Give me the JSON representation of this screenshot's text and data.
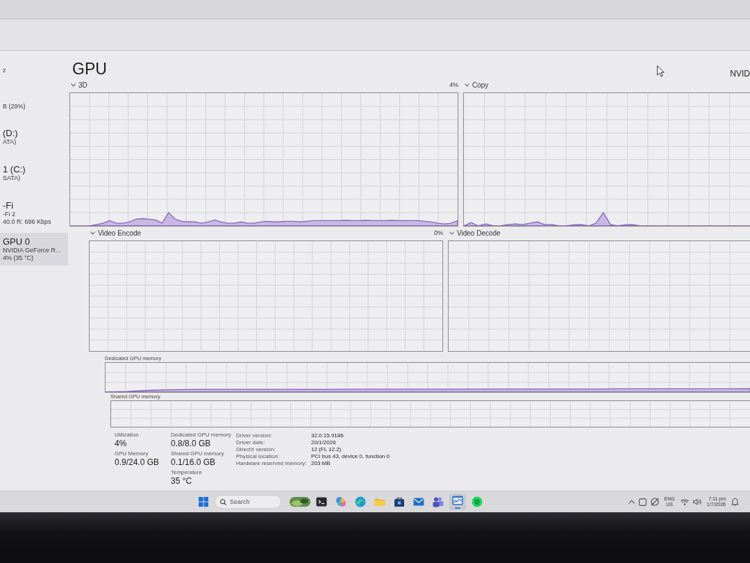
{
  "sidebar": {
    "items": [
      {
        "details": [
          "z"
        ],
        "selected": false
      },
      {
        "details": [
          "B (29%)"
        ],
        "selected": false
      },
      {
        "title": "(D:)",
        "details": [
          "ATA)"
        ],
        "selected": false
      },
      {
        "title": "1 (C:)",
        "details": [
          "SATA)"
        ],
        "selected": false
      },
      {
        "title": "-Fi",
        "details": [
          "-Fi 2",
          "40.0 R: 696 Kbps"
        ],
        "selected": false
      },
      {
        "title": "GPU 0",
        "details": [
          "NVIDIA GeForce R...",
          "4% (35 °C)"
        ],
        "selected": true
      }
    ]
  },
  "header": {
    "title": "GPU",
    "device": "NVID"
  },
  "engine_graphs": [
    {
      "label": "3D",
      "reading": "4%"
    },
    {
      "label": "Copy"
    },
    {
      "label": "Video Encode",
      "reading": "0%"
    },
    {
      "label": "Video Decode"
    }
  ],
  "memory_graphs": [
    {
      "label": "Dedicated GPU memory"
    },
    {
      "label": "Shared GPU memory"
    }
  ],
  "stat_columns": [
    [
      {
        "label": "Utilization",
        "value": "4%"
      },
      {
        "label": "GPU Memory",
        "value": "0.9/24.0 GB"
      }
    ],
    [
      {
        "label": "Dedicated GPU memory",
        "value": "0.8/8.0 GB"
      },
      {
        "label": "Shared GPU memory",
        "value": "0.1/16.0 GB"
      },
      {
        "label": "Temperature",
        "value": "35 °C"
      }
    ]
  ],
  "properties": [
    {
      "label": "Driver version:",
      "value": "32.0.15.9186"
    },
    {
      "label": "Driver date:",
      "value": "20/1/2026"
    },
    {
      "label": "DirectX version:",
      "value": "12 (FL 12.2)"
    },
    {
      "label": "Physical location:",
      "value": "PCI bus 43, device 0, function 0"
    },
    {
      "label": "Hardware reserved memory:",
      "value": "203 MB"
    }
  ],
  "taskbar": {
    "search": {
      "placeholder": "Search"
    },
    "apps": [
      {
        "selected": false
      },
      {
        "selected": false
      },
      {
        "selected": false
      },
      {
        "selected": false
      },
      {
        "selected": false
      },
      {
        "selected": false
      },
      {
        "selected": false
      },
      {
        "selected": true
      },
      {
        "selected": false
      }
    ],
    "language": "ENG",
    "region": "US",
    "time": "7:11 pm",
    "date": "1/7/2026"
  }
}
